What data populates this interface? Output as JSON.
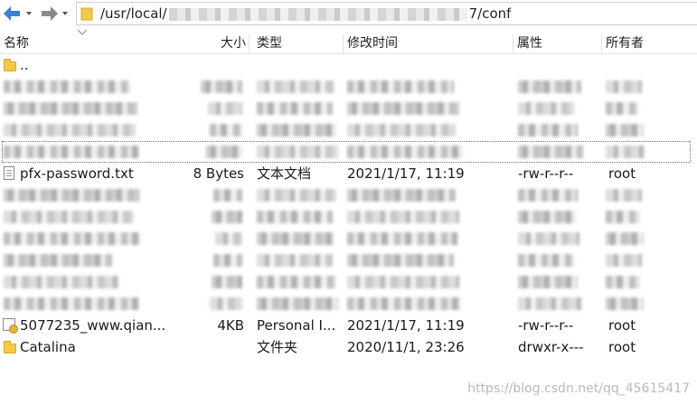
{
  "toolbar": {
    "back_icon": "arrow-left-icon",
    "forward_icon": "arrow-right-icon",
    "dropdown_icon": "chevron-down-icon",
    "folder_icon": "folder-icon",
    "path_prefix": "/usr/local/",
    "path_suffix": "7/conf"
  },
  "columns": {
    "name": "名称",
    "size": "大小",
    "type": "类型",
    "mtime": "修改时间",
    "attr": "属性",
    "owner": "所有者"
  },
  "rows": {
    "parent": {
      "name": "..",
      "icon": "folder-icon"
    },
    "pfx": {
      "name": "pfx-password.txt",
      "size": "8 Bytes",
      "type": "文本文档",
      "mtime": "2021/1/17, 11:19",
      "attr": "-rw-r--r--",
      "owner": "root",
      "icon": "document-icon"
    },
    "cert": {
      "name": "5077235_www.qian...",
      "size": "4KB",
      "type": "Personal I...",
      "mtime": "2021/1/17, 11:19",
      "attr": "-rw-r--r--",
      "owner": "root",
      "icon": "certificate-icon"
    },
    "catalina": {
      "name": "Catalina",
      "size": "",
      "type": "文件夹",
      "mtime": "2020/11/1, 23:26",
      "attr": "drwxr-x---",
      "owner": "root",
      "icon": "folder-icon"
    }
  },
  "watermark": "https://blog.csdn.net/qq_45615417",
  "colors": {
    "folder": "#f3c94a",
    "nav_arrow": "#3c7fd1"
  }
}
